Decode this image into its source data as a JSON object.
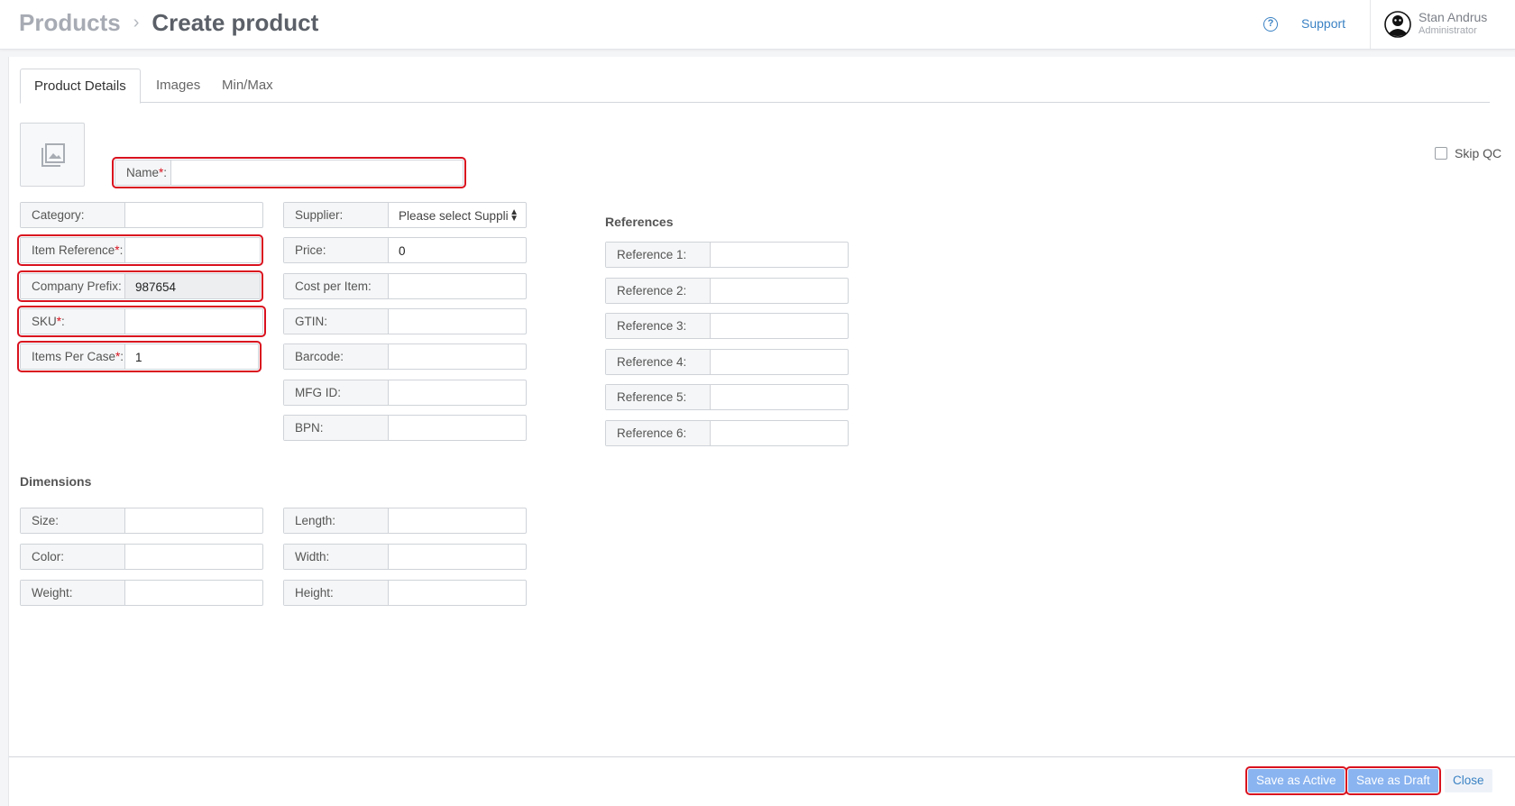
{
  "header": {
    "breadcrumb_root": "Products",
    "breadcrumb_sep": "›",
    "page_title": "Create product",
    "support_label": "Support",
    "user_name": "Stan Andrus",
    "user_role": "Administrator"
  },
  "tabs": [
    "Product Details",
    "Images",
    "Min/Max"
  ],
  "skip_qc_label": "Skip QC",
  "name_field": {
    "label": "Name",
    "value": ""
  },
  "left_fields": [
    {
      "label": "Category:",
      "value": ""
    },
    {
      "label": "Item Reference",
      "value": ""
    },
    {
      "label": "Company Prefix:",
      "value": "987654"
    },
    {
      "label": "SKU",
      "value": ""
    },
    {
      "label": "Items Per Case",
      "value": "1"
    }
  ],
  "mid_fields": [
    {
      "label": "Supplier:",
      "value": "Please select Suppli"
    },
    {
      "label": "Price:",
      "value": "0"
    },
    {
      "label": "Cost per Item:",
      "value": ""
    },
    {
      "label": "GTIN:",
      "value": ""
    },
    {
      "label": "Barcode:",
      "value": ""
    },
    {
      "label": "MFG ID:",
      "value": ""
    },
    {
      "label": "BPN:",
      "value": ""
    }
  ],
  "references_title": "References",
  "references": [
    {
      "label": "Reference 1:",
      "value": ""
    },
    {
      "label": "Reference 2:",
      "value": ""
    },
    {
      "label": "Reference 3:",
      "value": ""
    },
    {
      "label": "Reference 4:",
      "value": ""
    },
    {
      "label": "Reference 5:",
      "value": ""
    },
    {
      "label": "Reference 6:",
      "value": ""
    }
  ],
  "dimensions_title": "Dimensions",
  "dimensions_left": [
    {
      "label": "Size:",
      "value": ""
    },
    {
      "label": "Color:",
      "value": ""
    },
    {
      "label": "Weight:",
      "value": ""
    }
  ],
  "dimensions_right": [
    {
      "label": "Length:",
      "value": ""
    },
    {
      "label": "Width:",
      "value": ""
    },
    {
      "label": "Height:",
      "value": ""
    }
  ],
  "required_suffix": "*",
  "footer": {
    "save_active": "Save as Active",
    "save_draft": "Save as Draft",
    "close": "Close"
  },
  "colors": {
    "accent": "#3b82c4",
    "required": "#d9121f",
    "primary_button": "#8ab4f0"
  }
}
